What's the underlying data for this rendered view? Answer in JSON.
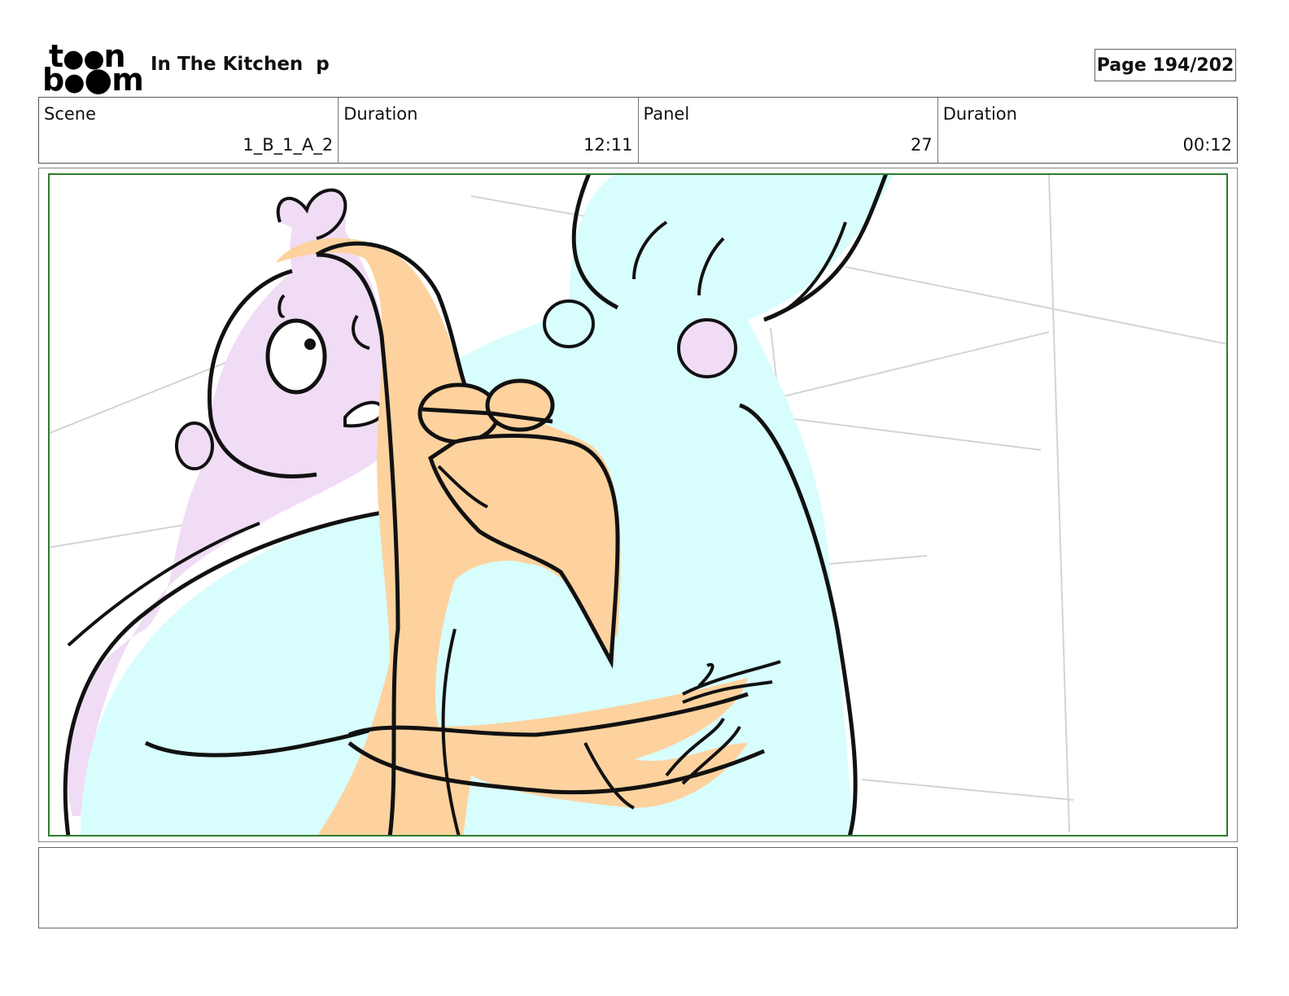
{
  "header": {
    "logo_top": "t••n",
    "logo_bottom": "b••m",
    "logo_text": "toon boom",
    "project_title": "In The Kitchen  p",
    "page_label": "Page 194/202"
  },
  "info": {
    "scene_label": "Scene",
    "scene_value": "1_B_1_A_2",
    "scene_duration_label": "Duration",
    "scene_duration_value": "12:11",
    "panel_label": "Panel",
    "panel_value": "27",
    "panel_duration_label": "Duration",
    "panel_duration_value": "00:12"
  },
  "panel": {
    "image_subject": "storyboard sketch",
    "colors": {
      "skin": "#fdd29e",
      "cyan": "#d8fdfd",
      "lilac": "#f0dcf5",
      "safe_frame": "#2e7d2e",
      "ink": "#111111"
    }
  },
  "notes": {
    "text": ""
  }
}
